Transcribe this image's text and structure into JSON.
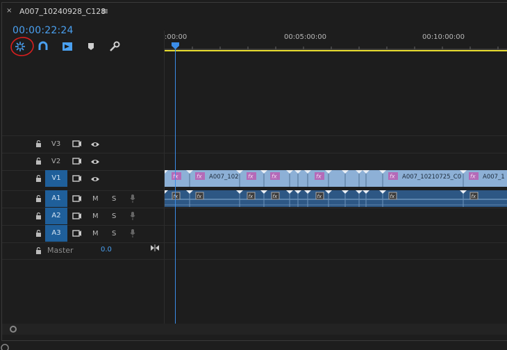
{
  "window": {
    "close_glyph": "×",
    "title": "A007_10240928_C128",
    "menu_glyph": "≡"
  },
  "timeline": {
    "timecode": "00:00:22:24",
    "ruler_labels": [
      ":00:00",
      "00:05:00:00",
      "00:10:00:00"
    ],
    "accent_color": "#4aa0f0",
    "workarea_color": "#e7dc2f"
  },
  "toolbar": {
    "icons": [
      "snap-icon",
      "linked-selection-icon",
      "captions-icon",
      "add-marker-icon",
      "timeline-settings-icon"
    ]
  },
  "tracks": {
    "video": [
      {
        "name": "V3",
        "targeted": false
      },
      {
        "name": "V2",
        "targeted": false
      },
      {
        "name": "V1",
        "targeted": true,
        "source_label": "V1"
      }
    ],
    "audio": [
      {
        "name": "A1",
        "m": "M",
        "s": "S"
      },
      {
        "name": "A2",
        "m": "M",
        "s": "S"
      },
      {
        "name": "A3",
        "m": "M",
        "s": "S"
      }
    ],
    "master": {
      "label": "Master",
      "value": "0.0"
    }
  },
  "clips": {
    "fx_label": "fx",
    "v1_names": [
      "A007_102",
      "A007_10210725_C0",
      "A007_1"
    ]
  }
}
